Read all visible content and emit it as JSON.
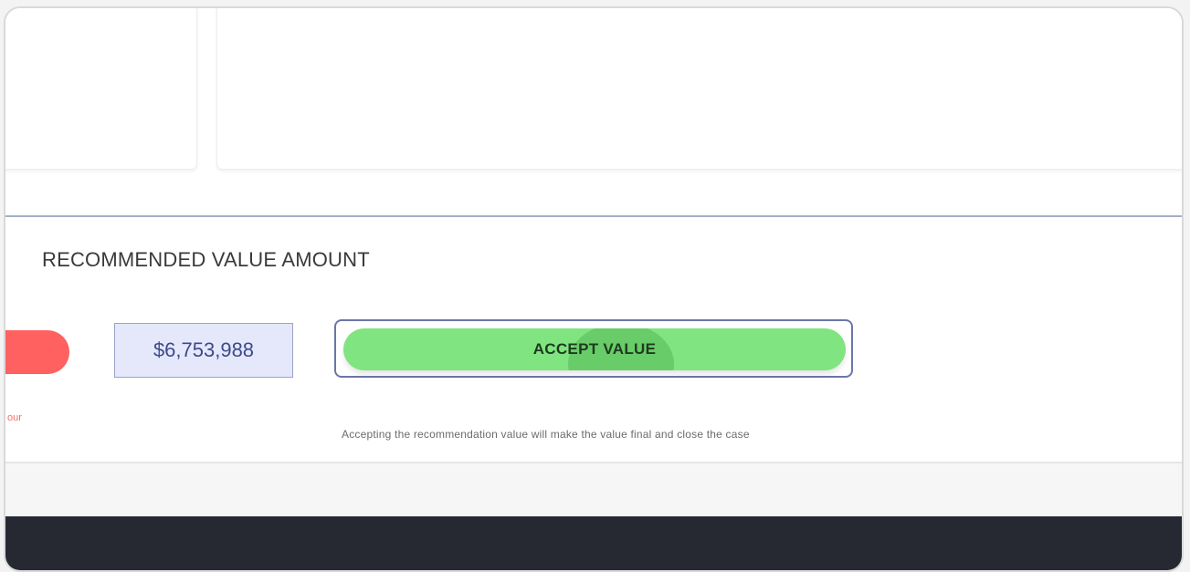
{
  "section": {
    "title": "RECOMMENDED VALUE AMOUNT",
    "left_truncated_text": "our",
    "value_amount": "$6,753,988",
    "accept_button_label": "ACCEPT VALUE",
    "helper_text": "Accepting the recommendation value will make the value final and close the case"
  },
  "colors": {
    "accept_button": "#80e480",
    "reject_button": "#ff6161",
    "value_box_bg": "#e5e8fb",
    "footer_bg": "#262932"
  }
}
